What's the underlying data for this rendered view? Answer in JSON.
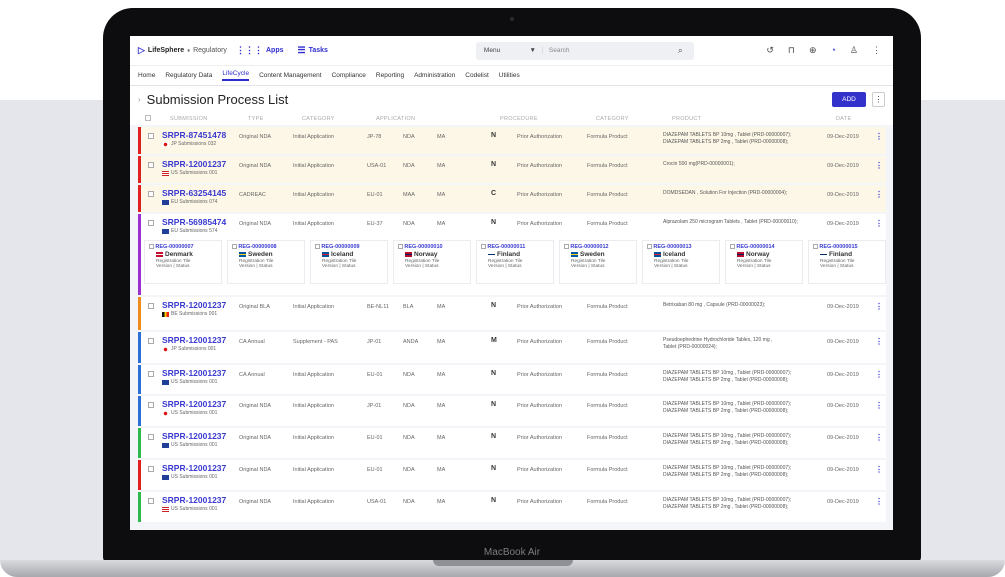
{
  "device": {
    "label": "MacBook Air"
  },
  "app": {
    "logo": "LifeSphere",
    "logo_sub": "Regulatory",
    "apps_label": "Apps",
    "tasks_label": "Tasks",
    "search": {
      "scope": "Menu",
      "placeholder": "Search"
    }
  },
  "nav_tabs": [
    "Home",
    "Regulatory Data",
    "LifeCycle",
    "Content Management",
    "Compliance",
    "Reporting",
    "Administration",
    "Codelist",
    "Utilities"
  ],
  "active_tab": "LifeCycle",
  "page": {
    "title": "Submission Process List",
    "add_label": "ADD"
  },
  "columns": [
    "SUBMISSION",
    "TYPE",
    "CATEGORY",
    "APPLICATION",
    "PROCEDURE",
    "CATEGORY",
    "PRODUCT",
    "DATE"
  ],
  "rows": [
    {
      "id": "SRPR-87451478",
      "sub": "JP Submissions 032",
      "flag": "jp",
      "type": "Original NDA",
      "category": "Initial Application",
      "app": "JP-78",
      "kind": "NDA",
      "ma": "MA",
      "letter": "N",
      "procedure": "Prior Authorization",
      "pcat": "Formula Product",
      "product": [
        "DIAZEPAM TABLETS BP 10mg , Tablet (PRD-00000007);",
        "DIAZEPAM TABLETS BP  2mg , Tablet (PRD-00000008);"
      ],
      "date": "09-Dec-2019",
      "accent": "#e02020",
      "hi": true
    },
    {
      "id": "SRPR-12001237",
      "sub": "US Submissions 001",
      "flag": "us",
      "type": "Original NDA",
      "category": "Initial Application",
      "app": "USA-01",
      "kind": "NDA",
      "ma": "MA",
      "letter": "N",
      "procedure": "Prior Authorization",
      "pcat": "Formula Product",
      "product": [
        "Crocin 500 mg(PRD-00000001);"
      ],
      "date": "09-Dec-2019",
      "accent": "#e02020",
      "hi": true
    },
    {
      "id": "SRPR-63254145",
      "sub": "EU Submissions 074",
      "flag": "eu",
      "type": "CADREAC",
      "category": "Initial Application",
      "app": "EU-01",
      "kind": "MAA",
      "ma": "MA",
      "letter": "C",
      "procedure": "Prior Authorization",
      "pcat": "Formula Product",
      "product": [
        "DOMDSEDAN , Solution For Injection (PRD-00000004);"
      ],
      "date": "09-Dec-2019",
      "accent": "#e02020",
      "hi": true
    },
    {
      "id": "SRPR-56985474",
      "sub": "EU Submissions 574",
      "flag": "eu",
      "type": "Original NDA",
      "category": "Initial Application",
      "app": "EU-37",
      "kind": "NDA",
      "ma": "MA",
      "letter": "N",
      "procedure": "Prior Authorization",
      "pcat": "Formula Product",
      "product": [
        "Alprazolam 250 microgram Tablets , Tablet (PRD-00000010);"
      ],
      "date": "09-Dec-2019",
      "accent": "#9b2fd0",
      "hi": false
    },
    {
      "id": "SRPR-12001237",
      "sub": "BE Submissions 001",
      "flag": "be",
      "type": "Original BLA",
      "category": "Initial Application",
      "app": "BE-NL11",
      "kind": "BLA",
      "ma": "MA",
      "letter": "N",
      "procedure": "Prior Authorization",
      "pcat": "Formula Product",
      "product": [
        "Betrixaban 80 mg , Capsule (PRD-00000023);"
      ],
      "date": "09-Dec-2019",
      "accent": "#f08a1c",
      "hi": false
    },
    {
      "id": "SRPR-12001237",
      "sub": "JP Submissions 001",
      "flag": "jp",
      "type": "CA Annual",
      "category": "Supplement - PAS",
      "app": "JP-01",
      "kind": "ANDA",
      "ma": "MA",
      "letter": "M",
      "procedure": "Prior Authorization",
      "pcat": "Formula Product",
      "product": [
        "Pseudoephedrine Hydrochloride Tables, 120 mg ,",
        "Tablet (PRD-00000024);"
      ],
      "date": "09-Dec-2019",
      "accent": "#2b6fd6",
      "hi": false
    },
    {
      "id": "SRPR-12001237",
      "sub": "US Submissions 001",
      "flag": "eu",
      "type": "CA Annual",
      "category": "Initial Application",
      "app": "EU-01",
      "kind": "NDA",
      "ma": "MA",
      "letter": "N",
      "procedure": "Prior Authorization",
      "pcat": "Formula Product",
      "product": [
        "DIAZEPAM TABLETS BP 10mg , Tablet (PRD-00000007);",
        "DIAZEPAM TABLETS BP  2mg , Tablet (PRD-00000008);"
      ],
      "date": "09-Dec-2019",
      "accent": "#2b6fd6",
      "hi": false
    },
    {
      "id": "SRPR-12001237",
      "sub": "US Submissions 001",
      "flag": "jp",
      "type": "Original NDA",
      "category": "Initial Application",
      "app": "JP-01",
      "kind": "NDA",
      "ma": "MA",
      "letter": "N",
      "procedure": "Prior Authorization",
      "pcat": "Formula Product",
      "product": [
        "DIAZEPAM TABLETS BP 10mg , Tablet (PRD-00000007);",
        "DIAZEPAM TABLETS BP  2mg , Tablet (PRD-00000008);"
      ],
      "date": "09-Dec-2019",
      "accent": "#2b6fd6",
      "hi": false
    },
    {
      "id": "SRPR-12001237",
      "sub": "US Submissions 001",
      "flag": "eu",
      "type": "Original NDA",
      "category": "Initial Application",
      "app": "EU-01",
      "kind": "NDA",
      "ma": "MA",
      "letter": "N",
      "procedure": "Prior Authorization",
      "pcat": "Formula Product",
      "product": [
        "DIAZEPAM TABLETS BP 10mg , Tablet (PRD-00000007);",
        "DIAZEPAM TABLETS BP  2mg , Tablet (PRD-00000008);"
      ],
      "date": "09-Dec-2019",
      "accent": "#2db84c",
      "hi": false
    },
    {
      "id": "SRPR-12001237",
      "sub": "US Submissions 001",
      "flag": "eu",
      "type": "Original NDA",
      "category": "Initial Application",
      "app": "EU-01",
      "kind": "NDA",
      "ma": "MA",
      "letter": "N",
      "procedure": "Prior Authorization",
      "pcat": "Formula Product",
      "product": [
        "DIAZEPAM TABLETS BP 10mg , Tablet (PRD-00000007);",
        "DIAZEPAM TABLETS BP  2mg , Tablet (PRD-00000008);"
      ],
      "date": "09-Dec-2019",
      "accent": "#e02020",
      "hi": false
    },
    {
      "id": "SRPR-12001237",
      "sub": "US Submissions 001",
      "flag": "us",
      "type": "Original NDA",
      "category": "Initial Application",
      "app": "USA-01",
      "kind": "NDA",
      "ma": "MA",
      "letter": "N",
      "procedure": "Prior Authorization",
      "pcat": "Formula Product",
      "product": [
        "DIAZEPAM TABLETS BP 10mg , Tablet (PRD-00000007);",
        "DIAZEPAM TABLETS BP  2mg , Tablet (PRD-00000008);"
      ],
      "date": "09-Dec-2019",
      "accent": "#2db84c",
      "hi": false
    }
  ],
  "registrations": [
    {
      "id": "REG-00000007",
      "country": "Denmark",
      "flag": "dk"
    },
    {
      "id": "REG-00000008",
      "country": "Sweden",
      "flag": "se"
    },
    {
      "id": "REG-00000009",
      "country": "Iceland",
      "flag": "is"
    },
    {
      "id": "REG-00000010",
      "country": "Norway",
      "flag": "no"
    },
    {
      "id": "REG-00000011",
      "country": "Finland",
      "flag": "fi"
    },
    {
      "id": "REG-00000012",
      "country": "Sweden",
      "flag": "se"
    },
    {
      "id": "REG-00000013",
      "country": "Iceland",
      "flag": "is"
    },
    {
      "id": "REG-00000014",
      "country": "Norway",
      "flag": "no"
    },
    {
      "id": "REG-00000015",
      "country": "Finland",
      "flag": "fi"
    }
  ],
  "reg_labels": {
    "title": "Registration Tile",
    "status": "Version | Status"
  },
  "colors": {
    "accent": "#3333cc",
    "highlight": "#fdf7e7"
  }
}
